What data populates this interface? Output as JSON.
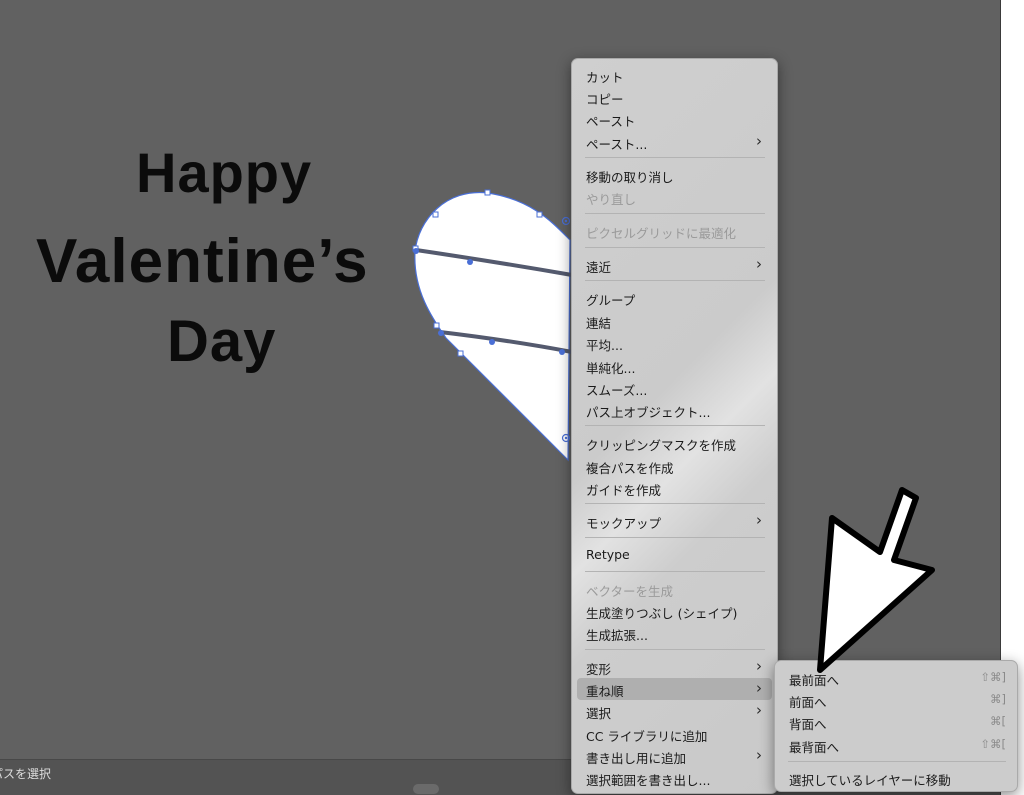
{
  "canvas": {
    "title_lines": [
      "Happy",
      "Valentine’s",
      "Day"
    ]
  },
  "status_bar": {
    "text": "パスを選択"
  },
  "context_menu": {
    "items": [
      {
        "label": "カット"
      },
      {
        "label": "コピー"
      },
      {
        "label": "ペースト"
      },
      {
        "label": "ペースト...",
        "submenu": true
      },
      {
        "label": "移動の取り消し"
      },
      {
        "label": "やり直し",
        "disabled": true
      },
      {
        "label": "ピクセルグリッドに最適化",
        "disabled": true
      },
      {
        "label": "遠近",
        "submenu": true
      },
      {
        "label": "グループ"
      },
      {
        "label": "連結"
      },
      {
        "label": "平均..."
      },
      {
        "label": "単純化..."
      },
      {
        "label": "スムーズ..."
      },
      {
        "label": "パス上オブジェクト..."
      },
      {
        "label": "クリッピングマスクを作成"
      },
      {
        "label": "複合パスを作成"
      },
      {
        "label": "ガイドを作成"
      },
      {
        "label": "モックアップ",
        "submenu": true
      },
      {
        "label": "Retype"
      },
      {
        "label": "ベクターを生成",
        "disabled": true
      },
      {
        "label": "生成塗りつぶし (シェイプ)"
      },
      {
        "label": "生成拡張..."
      },
      {
        "label": "変形",
        "submenu": true
      },
      {
        "label": "重ね順",
        "submenu": true,
        "highlighted": true
      },
      {
        "label": "選択",
        "submenu": true
      },
      {
        "label": "CC ライブラリに追加"
      },
      {
        "label": "書き出し用に追加",
        "submenu": true
      },
      {
        "label": "選択範囲を書き出し..."
      }
    ]
  },
  "arrange_submenu": {
    "items": [
      {
        "label": "最前面へ",
        "shortcut": "⇧⌘]"
      },
      {
        "label": "前面へ",
        "shortcut": "⌘]"
      },
      {
        "label": "背面へ",
        "shortcut": "⌘["
      },
      {
        "label": "最背面へ",
        "shortcut": "⇧⌘["
      },
      {
        "label": "選択しているレイヤーに移動",
        "shortcut": ""
      }
    ]
  },
  "icons": {
    "submenu_arrow": "chevron-right-icon",
    "pointer": "large-arrow-pointer-icon"
  },
  "colors": {
    "canvas_bg": "#616161",
    "selection_blue": "#4a6fd6",
    "menu_bg": "#cccccc",
    "menu_highlight": "#afafaf",
    "heart_fill": "#ffffff",
    "stripe": "#545a6e"
  }
}
